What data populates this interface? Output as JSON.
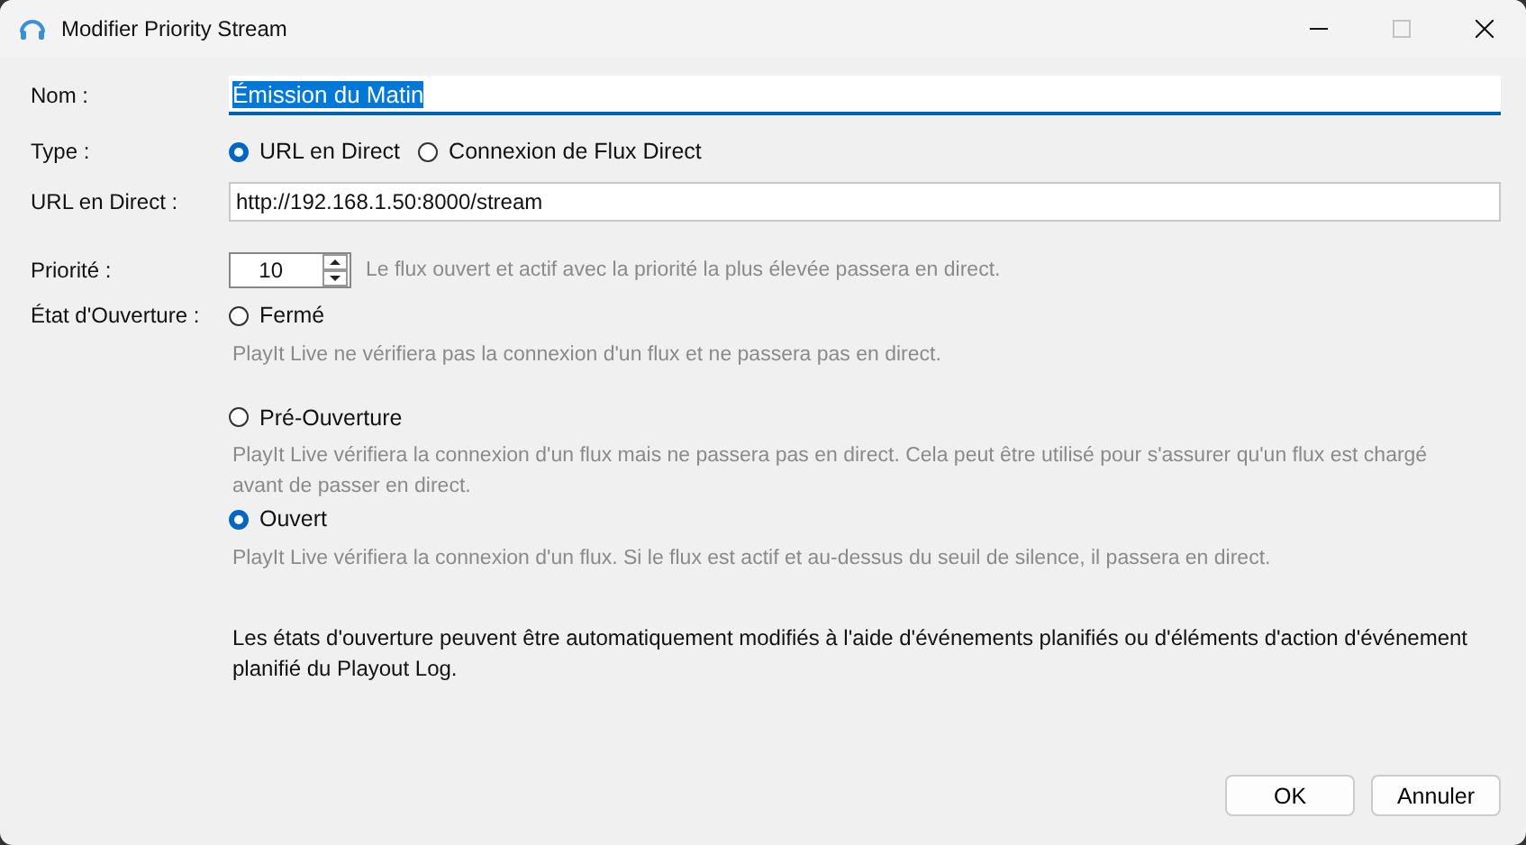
{
  "window": {
    "title": "Modifier Priority Stream",
    "maximize_disabled": true
  },
  "name_field": {
    "label": "Nom :",
    "value": "Émission du Matin",
    "text_selected": true
  },
  "type": {
    "label": "Type :",
    "options": [
      {
        "label": "URL en Direct",
        "selected": true
      },
      {
        "label": "Connexion de Flux Direct",
        "selected": false
      }
    ]
  },
  "url_field": {
    "label": "URL en Direct :",
    "value": "http://192.168.1.50:8000/stream"
  },
  "priority": {
    "label": "Priorité :",
    "value": "10",
    "hint": "Le flux ouvert et actif avec la priorité la plus élevée passera en direct."
  },
  "open_state": {
    "label": "État d'Ouverture :",
    "options": [
      {
        "label": "Fermé",
        "selected": false,
        "description": "PlayIt Live ne vérifiera pas la connexion d'un flux et ne passera pas en direct."
      },
      {
        "label": "Pré-Ouverture",
        "selected": false,
        "description": "PlayIt Live vérifiera la connexion d'un flux mais ne passera pas en direct. Cela peut être utilisé pour s'assurer qu'un flux est chargé avant de passer en direct."
      },
      {
        "label": "Ouvert",
        "selected": true,
        "description": "PlayIt Live vérifiera la connexion d'un flux. Si le flux est actif et au-dessus du seuil de silence, il passera en direct."
      }
    ]
  },
  "note": "Les états d'ouverture peuvent être automatiquement modifiés à l'aide d'événements planifiés ou d'éléments d'action d'événement planifié du Playout Log.",
  "buttons": [
    "OK",
    "Annuler"
  ]
}
